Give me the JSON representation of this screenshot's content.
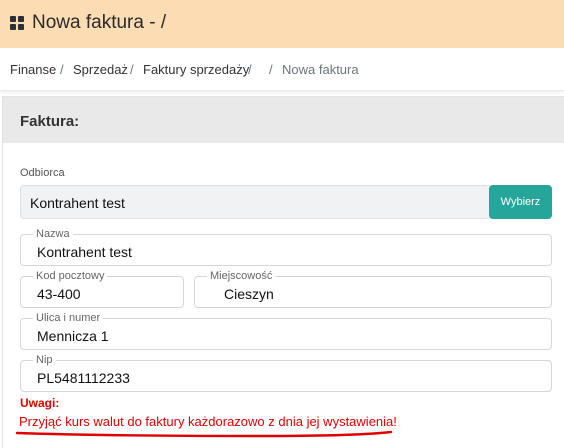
{
  "header": {
    "title": "Nowa faktura - /",
    "logo_icon": "grid-icon",
    "background": "#fbdcb3"
  },
  "breadcrumb": {
    "items": [
      "Finanse",
      "Sprzedaż",
      "Faktury sprzedaży",
      "",
      "Nowa faktura"
    ],
    "separator": "/"
  },
  "card": {
    "title": "Faktura:"
  },
  "form": {
    "recipient": {
      "label": "Odbiorca",
      "value": "Kontrahent test",
      "button_label": "Wybierz",
      "button_color": "#26a69a"
    },
    "name": {
      "label": "Nazwa",
      "value": "Kontrahent test"
    },
    "postal_code": {
      "label": "Kod pocztowy",
      "value": "43-400"
    },
    "city": {
      "label": "Miejscowość",
      "value": "Cieszyn"
    },
    "street": {
      "label": "Ulica i numer",
      "value": "Mennicza 1"
    },
    "nip": {
      "label": "Nip",
      "value": "PL5481112233"
    }
  },
  "notes": {
    "title": "Uwagi:",
    "text": "Przyjąć kurs walut do faktury każdorazowo z dnia jej wystawienia!",
    "color": "#e00000"
  }
}
